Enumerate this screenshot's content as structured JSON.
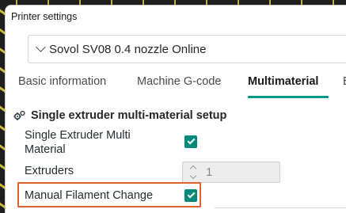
{
  "window": {
    "title": "Printer settings"
  },
  "preset": {
    "selected": "Sovol SV08 0.4 nozzle Online"
  },
  "tabs": [
    {
      "label": "Basic information"
    },
    {
      "label": "Machine G-code"
    },
    {
      "label": "Multimaterial",
      "active": true
    },
    {
      "label": "E"
    }
  ],
  "section": {
    "title": "Single extruder multi-material setup",
    "icon": "gear-cluster-icon"
  },
  "settings": {
    "single_extruder_multi_material": {
      "label": "Single Extruder Multi Material",
      "label_line1": "Single Extruder Multi",
      "label_line2": "Material",
      "checked": true
    },
    "extruders": {
      "label": "Extruders",
      "value": "1"
    },
    "manual_filament_change": {
      "label": "Manual Filament Change",
      "checked": true
    }
  },
  "colors": {
    "accent": "#009688",
    "checkbox": "#00897b",
    "highlight": "#e0622e"
  }
}
